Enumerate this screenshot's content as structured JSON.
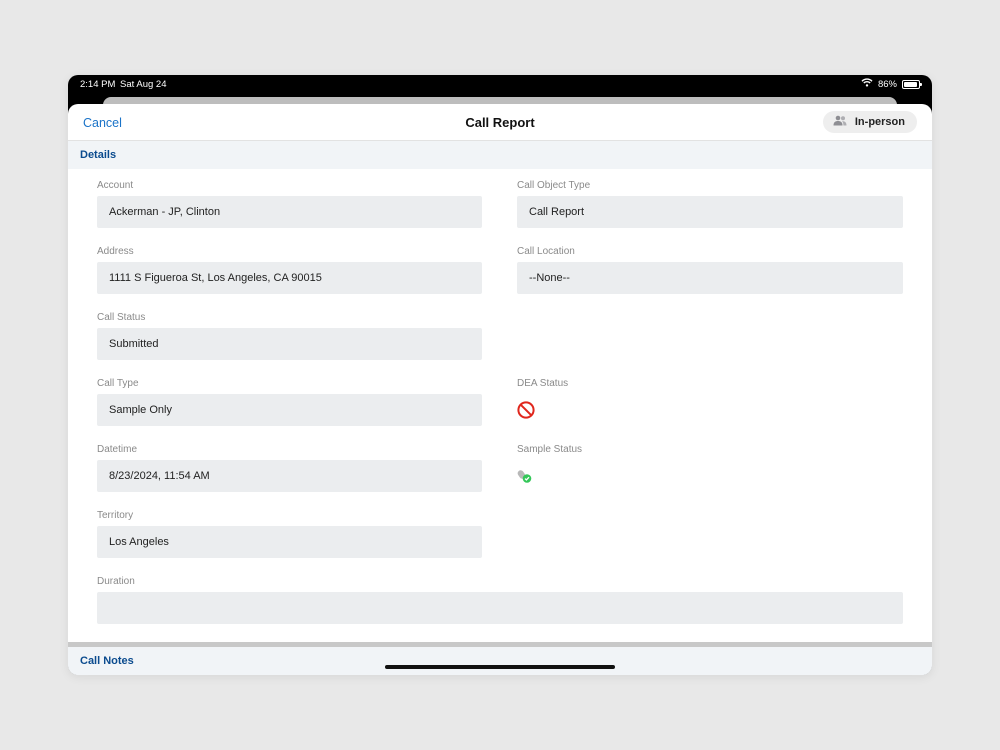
{
  "status_bar": {
    "time": "2:14 PM",
    "date": "Sat Aug 24",
    "battery": "86%",
    "battery_level": 0.86
  },
  "nav": {
    "cancel_label": "Cancel",
    "title": "Call Report",
    "mode_label": "In-person",
    "mode_icon": "people-icon"
  },
  "sections": {
    "details": "Details",
    "call_notes": "Call Notes"
  },
  "fields": {
    "account": {
      "label": "Account",
      "value": "Ackerman - JP, Clinton"
    },
    "call_object_type": {
      "label": "Call Object Type",
      "value": "Call Report"
    },
    "address": {
      "label": "Address",
      "value": "1111 S Figueroa St, Los Angeles, CA 90015"
    },
    "call_location": {
      "label": "Call Location",
      "value": "--None--"
    },
    "call_status": {
      "label": "Call Status",
      "value": "Submitted"
    },
    "call_type": {
      "label": "Call Type",
      "value": "Sample Only"
    },
    "dea_status": {
      "label": "DEA Status",
      "icon": "prohibited-icon"
    },
    "datetime": {
      "label": "Datetime",
      "value": "8/23/2024, 11:54 AM"
    },
    "sample_status": {
      "label": "Sample Status",
      "icon": "sample-check-icon"
    },
    "territory": {
      "label": "Territory",
      "value": "Los Angeles"
    },
    "duration": {
      "label": "Duration",
      "value": ""
    }
  },
  "colors": {
    "accent": "#1a73c8",
    "section_text": "#0b4b8e",
    "prohibited": "#e0271d",
    "success": "#34c759"
  }
}
